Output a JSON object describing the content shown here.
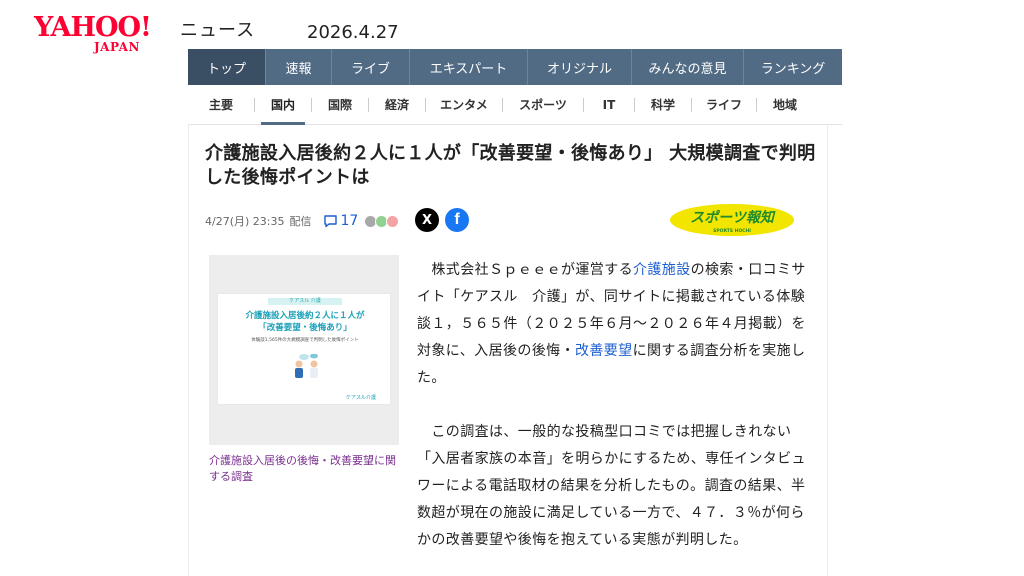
{
  "header": {
    "logo_main": "YAHOO!",
    "logo_sub": "JAPAN",
    "section": "ニュース",
    "date": "2026.4.27"
  },
  "nav_main": [
    {
      "label": "トップ",
      "active": true
    },
    {
      "label": "速報"
    },
    {
      "label": "ライブ"
    },
    {
      "label": "エキスパート"
    },
    {
      "label": "オリジナル"
    },
    {
      "label": "みんなの意見"
    },
    {
      "label": "ランキング"
    }
  ],
  "nav_sub": [
    {
      "label": "主要"
    },
    {
      "label": "国内",
      "active": true
    },
    {
      "label": "国際"
    },
    {
      "label": "経済"
    },
    {
      "label": "エンタメ"
    },
    {
      "label": "スポーツ"
    },
    {
      "label": "IT"
    },
    {
      "label": "科学"
    },
    {
      "label": "ライフ"
    },
    {
      "label": "地域"
    }
  ],
  "article": {
    "title": "介護施設入居後約２人に１人が「改善要望・後悔あり」 大規模調査で判明した後悔ポイントは",
    "timestamp": "4/27(月) 23:35",
    "distribution": "配信",
    "comment_count": "17",
    "source": "スポーツ報知",
    "source_sub": "SPORTS HOCHI",
    "image": {
      "tag": "ケアスル 介護",
      "headline_1": "介護施設入居後約２人に１人が",
      "headline_2": "「改善要望・後悔あり」",
      "subline": "体験談1,565件の大規模調査で判明した後悔ポイント",
      "brand": "ケアスル介護"
    },
    "caption": "介護施設入居後の後悔・改善要望に関する調査",
    "p1": [
      {
        "text": "　株式会社Ｓｐｅｅｅが運営する"
      },
      {
        "text": "介護施設",
        "link": true
      },
      {
        "text": "の検索・口コミサイト「ケアスル　介護」が、同サイトに掲載されている体験談１，５６５件（２０２５年６月～２０２６年４月掲載）を対象に、入居後の後悔・"
      },
      {
        "text": "改善要望",
        "link": true
      },
      {
        "text": "に関する調査分析を実施した。"
      }
    ],
    "p2": "　この調査は、一般的な投稿型口コミでは把握しきれない「入居者家族の本音」を明らかにするため、専任インタビュワーによる電話取材の結果を分析したもの。調査の結果、半数超が現在の施設に満足している一方で、４７．３％が何らかの改善要望や後悔を抱えている実態が判明した。"
  },
  "colors": {
    "brand_red": "#ff0033",
    "nav_bg": "#516b85",
    "nav_active": "#3a4f64",
    "link": "#1d5fd1",
    "caption": "#7b2f8e",
    "source_yellow": "#f2e600",
    "source_green": "#1f8a2e"
  }
}
